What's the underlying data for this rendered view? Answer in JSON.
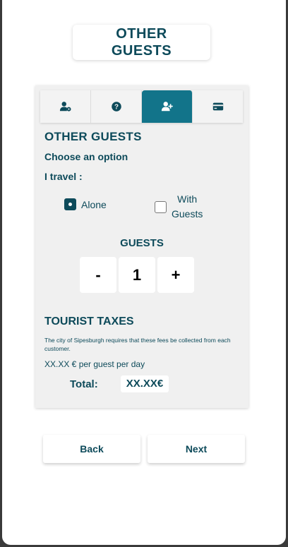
{
  "header": {
    "title_line1": "OTHER",
    "title_line2": "GUESTS"
  },
  "tabs": [
    {
      "icon": "user-gear-icon",
      "active": false
    },
    {
      "icon": "question-circle-icon",
      "active": false
    },
    {
      "icon": "user-plus-icon",
      "active": true
    },
    {
      "icon": "credit-card-icon",
      "active": false
    }
  ],
  "section": {
    "title": "OTHER GUESTS",
    "subtitle": "Choose an option",
    "travel_label": "I travel :"
  },
  "options": [
    {
      "label": "Alone",
      "checked": true
    },
    {
      "label_line1": "With",
      "label_line2": "Guests",
      "checked": false
    }
  ],
  "guests": {
    "title": "GUESTS",
    "minus": "-",
    "count": "1",
    "plus": "+"
  },
  "taxes": {
    "title": "TOURIST TAXES",
    "note": "The city of Sipesburgh requires that these fees be collected from each customer.",
    "rate": "XX.XX € per guest per day",
    "total_label": "Total:",
    "total_value": "XX.XX€"
  },
  "nav": {
    "back": "Back",
    "next": "Next"
  },
  "colors": {
    "primary": "#0d4a5a",
    "accent": "#12748a",
    "panel": "#f0f0f0"
  }
}
